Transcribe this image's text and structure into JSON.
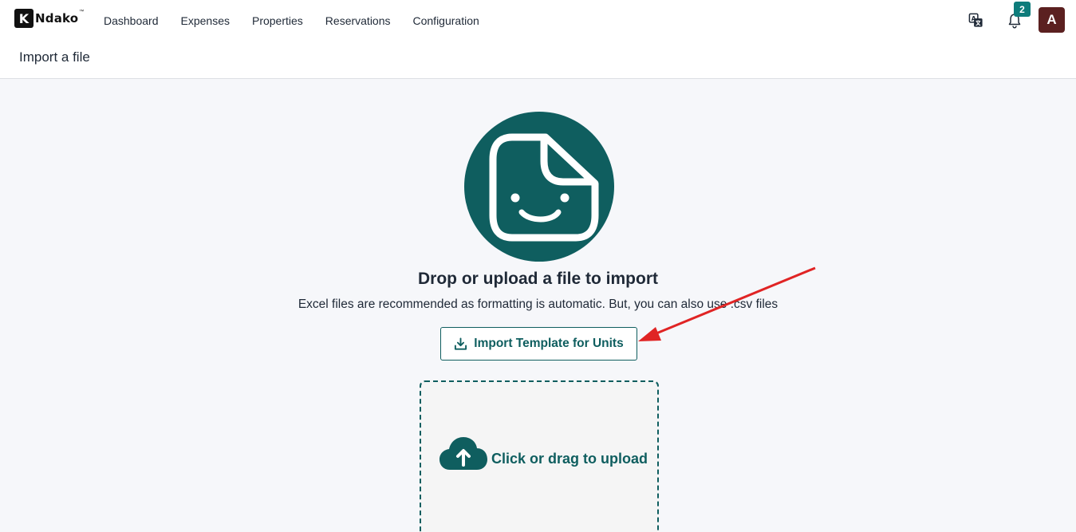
{
  "app": {
    "logo_letter": "K",
    "logo_text": "Ndako",
    "logo_tm": "™"
  },
  "nav": {
    "items": [
      {
        "label": "Dashboard"
      },
      {
        "label": "Expenses"
      },
      {
        "label": "Properties"
      },
      {
        "label": "Reservations"
      },
      {
        "label": "Configuration"
      }
    ]
  },
  "header_right": {
    "translate_icon": "translate-icon",
    "bell_icon": "bell-icon",
    "notification_count": "2",
    "avatar_letter": "A"
  },
  "page": {
    "title": "Import a file"
  },
  "import": {
    "hero_icon": "smiling-file-icon",
    "heading": "Drop or upload a file to import",
    "subtitle": "Excel files are recommended as formatting is automatic. But, you can also use .csv files",
    "template_button_label": "Import Template for Units",
    "template_button_icon": "download-icon",
    "dropzone_label": "Click or drag to upload",
    "dropzone_icon": "cloud-upload-icon"
  },
  "colors": {
    "accent": "#0f5e5f",
    "badge": "#0e7c7b",
    "avatar_bg": "#5b2020",
    "annotation_arrow": "#e02424"
  }
}
